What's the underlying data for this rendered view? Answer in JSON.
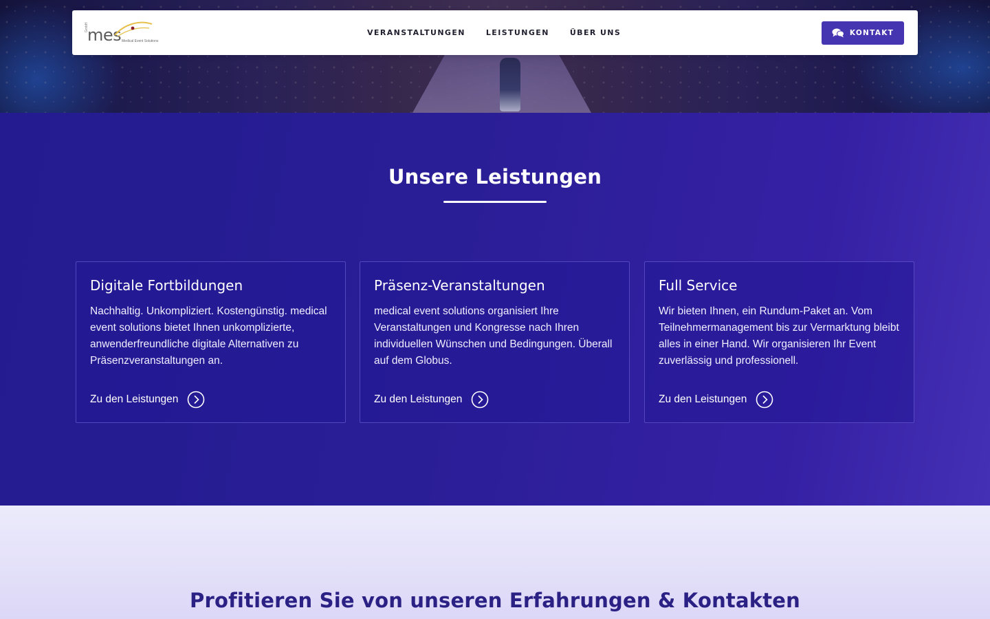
{
  "brand": {
    "logo_text": "mes",
    "logo_small": "GmbH",
    "logo_sub": "Medical Event Solutions"
  },
  "nav": {
    "items": [
      {
        "label": "VERANSTALTUNGEN"
      },
      {
        "label": "LEISTUNGEN"
      },
      {
        "label": "ÜBER UNS"
      }
    ],
    "contact_label": "KONTAKT",
    "contact_icon": "chat-bubbles-icon"
  },
  "services": {
    "title": "Unsere Leistungen",
    "cards": [
      {
        "title": "Digitale Fortbildungen",
        "text": "Nachhaltig. Unkompliziert. Kostengünstig. medical event solutions bietet Ihnen unkomplizierte, anwenderfreundliche digitale Alternativen zu Präsenzveranstaltungen an.",
        "link": "Zu den Leistungen"
      },
      {
        "title": "Präsenz-Veranstaltungen",
        "text": "medical event solutions organisiert Ihre Veranstaltungen und Kongresse nach Ihren individuellen Wünschen und Bedingungen. Überall auf dem Globus.",
        "link": "Zu den Leistungen"
      },
      {
        "title": "Full Service",
        "text": "Wir bieten Ihnen, ein Rundum-Paket an. Vom Teilnehmermanagement bis zur Vermarktung bleibt alles in einer Hand. Wir organisieren Ihr Event zuverlässig und professionell.",
        "link": "Zu den Leistungen"
      }
    ]
  },
  "experience": {
    "title": "Profitieren Sie von unseren Erfahrungen & Kontakten"
  },
  "colors": {
    "accent": "#4535b0",
    "section_bg": "#2a1e96",
    "light_bg": "#ecebfb",
    "heading_dark": "#2b2185"
  }
}
